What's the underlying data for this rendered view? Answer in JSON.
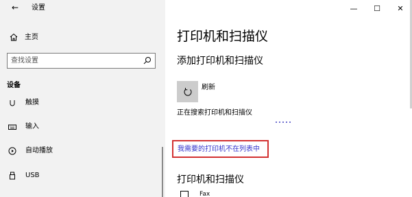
{
  "window": {
    "title": "设置",
    "back_glyph": "←",
    "minimize_glyph": "—",
    "maximize_glyph": "☐",
    "close_glyph": "✕"
  },
  "sidebar": {
    "home_label": "主页",
    "search_placeholder": "查找设置",
    "section_label": "设备",
    "items": [
      {
        "label": "触摸",
        "icon": "touchpad-icon"
      },
      {
        "label": "输入",
        "icon": "keyboard-icon"
      },
      {
        "label": "自动播放",
        "icon": "autoplay-icon"
      },
      {
        "label": "USB",
        "icon": "usb-icon"
      }
    ]
  },
  "main": {
    "page_title": "打印机和扫描仪",
    "add_heading": "添加打印机和扫描仪",
    "refresh_label": "刷新",
    "searching_text": "正在搜索打印机和扫描仪",
    "not_listed_link": "我需要的打印机不在列表中",
    "printers_heading": "打印机和扫描仪",
    "devices": [
      {
        "label": "Fax"
      }
    ]
  },
  "colors": {
    "sidebar_bg": "#f2f2f2",
    "link": "#3333cc",
    "highlight_box": "#d23030",
    "tile_bg": "#cccccc"
  }
}
